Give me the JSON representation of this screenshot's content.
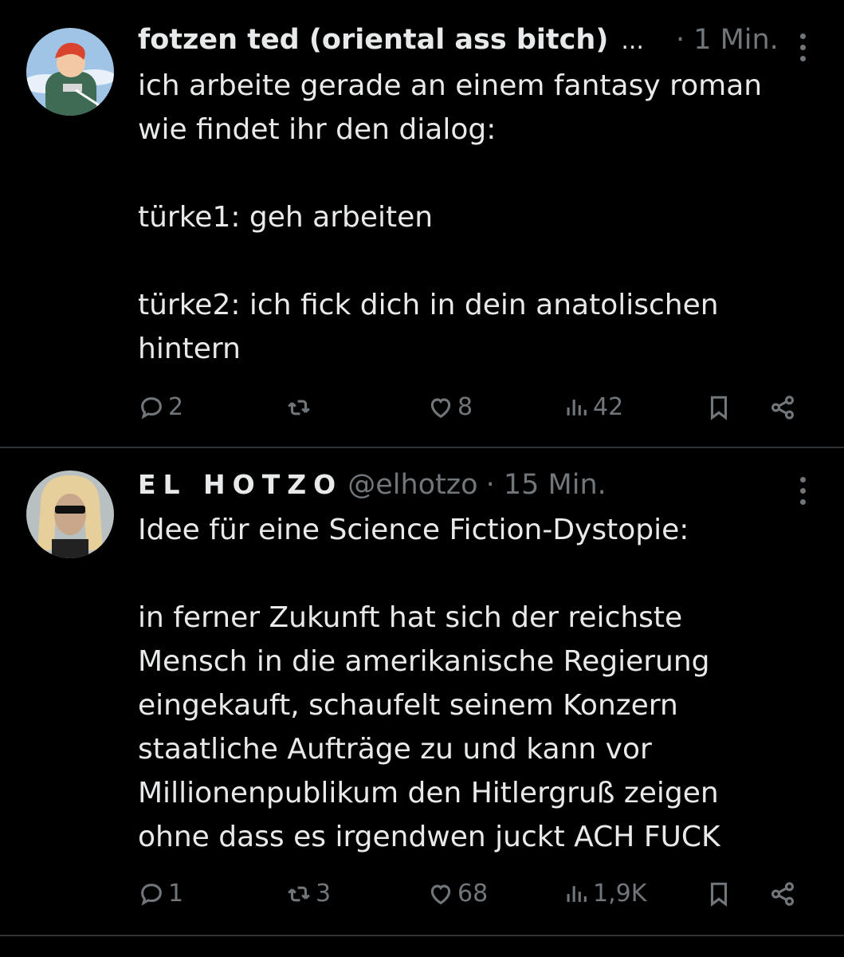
{
  "tweets": [
    {
      "author": "fotzen ted (oriental ass bitch)",
      "ellipsis": "...",
      "handle": "",
      "time": "· 1 Min.",
      "text": "ich arbeite gerade an einem fantasy roman\nwie findet ihr den dialog:\n\ntürke1: geh arbeiten\n\ntürke2: ich fick dich in dein anatolischen\nhintern",
      "replies": "2",
      "reposts": "",
      "likes": "8",
      "views": "42"
    },
    {
      "author": "EL HOTZO",
      "handle": "@elhotzo",
      "time": "· 15 Min.",
      "text": "Idee für eine Science Fiction-Dystopie:\n\nin ferner Zukunft hat sich der reichste\nMensch in die amerikanische Regierung\neingekauft, schaufelt seinem Konzern\nstaatliche Aufträge zu und kann vor\nMillionenpublikum den Hitlergruß zeigen\nohne dass es irgendwen juckt ACH FUCK",
      "replies": "1",
      "reposts": "3",
      "likes": "68",
      "views": "1,9K"
    }
  ],
  "icons": {
    "reply": "reply-icon",
    "repost": "repost-icon",
    "like": "heart-icon",
    "views": "views-icon",
    "bookmark": "bookmark-icon",
    "share": "share-icon",
    "more": "more-icon"
  },
  "colors": {
    "background": "#000000",
    "text": "#e7e9ea",
    "secondary": "#71767b",
    "divider": "#2f3336"
  }
}
